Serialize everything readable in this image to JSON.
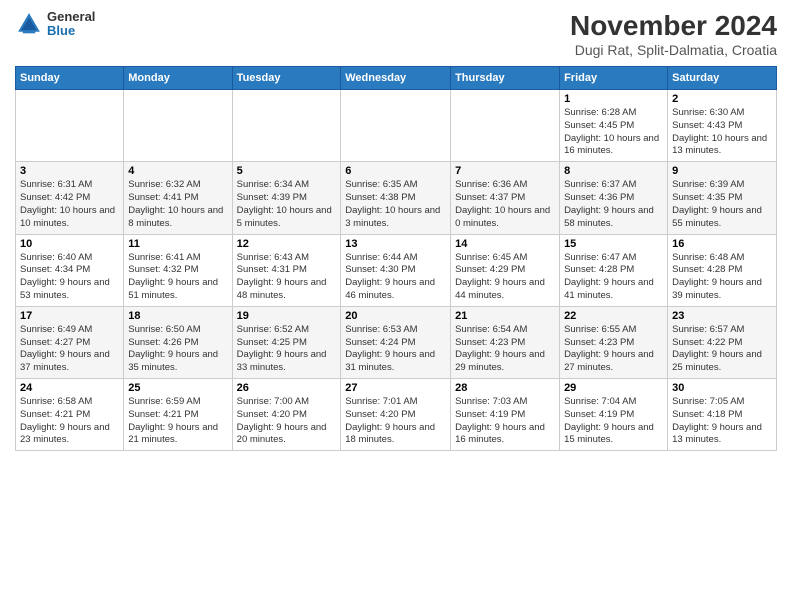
{
  "header": {
    "title": "November 2024",
    "location": "Dugi Rat, Split-Dalmatia, Croatia",
    "logo_general": "General",
    "logo_blue": "Blue"
  },
  "weekdays": [
    "Sunday",
    "Monday",
    "Tuesday",
    "Wednesday",
    "Thursday",
    "Friday",
    "Saturday"
  ],
  "weeks": [
    [
      {
        "day": "",
        "info": ""
      },
      {
        "day": "",
        "info": ""
      },
      {
        "day": "",
        "info": ""
      },
      {
        "day": "",
        "info": ""
      },
      {
        "day": "",
        "info": ""
      },
      {
        "day": "1",
        "info": "Sunrise: 6:28 AM\nSunset: 4:45 PM\nDaylight: 10 hours and 16 minutes."
      },
      {
        "day": "2",
        "info": "Sunrise: 6:30 AM\nSunset: 4:43 PM\nDaylight: 10 hours and 13 minutes."
      }
    ],
    [
      {
        "day": "3",
        "info": "Sunrise: 6:31 AM\nSunset: 4:42 PM\nDaylight: 10 hours and 10 minutes."
      },
      {
        "day": "4",
        "info": "Sunrise: 6:32 AM\nSunset: 4:41 PM\nDaylight: 10 hours and 8 minutes."
      },
      {
        "day": "5",
        "info": "Sunrise: 6:34 AM\nSunset: 4:39 PM\nDaylight: 10 hours and 5 minutes."
      },
      {
        "day": "6",
        "info": "Sunrise: 6:35 AM\nSunset: 4:38 PM\nDaylight: 10 hours and 3 minutes."
      },
      {
        "day": "7",
        "info": "Sunrise: 6:36 AM\nSunset: 4:37 PM\nDaylight: 10 hours and 0 minutes."
      },
      {
        "day": "8",
        "info": "Sunrise: 6:37 AM\nSunset: 4:36 PM\nDaylight: 9 hours and 58 minutes."
      },
      {
        "day": "9",
        "info": "Sunrise: 6:39 AM\nSunset: 4:35 PM\nDaylight: 9 hours and 55 minutes."
      }
    ],
    [
      {
        "day": "10",
        "info": "Sunrise: 6:40 AM\nSunset: 4:34 PM\nDaylight: 9 hours and 53 minutes."
      },
      {
        "day": "11",
        "info": "Sunrise: 6:41 AM\nSunset: 4:32 PM\nDaylight: 9 hours and 51 minutes."
      },
      {
        "day": "12",
        "info": "Sunrise: 6:43 AM\nSunset: 4:31 PM\nDaylight: 9 hours and 48 minutes."
      },
      {
        "day": "13",
        "info": "Sunrise: 6:44 AM\nSunset: 4:30 PM\nDaylight: 9 hours and 46 minutes."
      },
      {
        "day": "14",
        "info": "Sunrise: 6:45 AM\nSunset: 4:29 PM\nDaylight: 9 hours and 44 minutes."
      },
      {
        "day": "15",
        "info": "Sunrise: 6:47 AM\nSunset: 4:28 PM\nDaylight: 9 hours and 41 minutes."
      },
      {
        "day": "16",
        "info": "Sunrise: 6:48 AM\nSunset: 4:28 PM\nDaylight: 9 hours and 39 minutes."
      }
    ],
    [
      {
        "day": "17",
        "info": "Sunrise: 6:49 AM\nSunset: 4:27 PM\nDaylight: 9 hours and 37 minutes."
      },
      {
        "day": "18",
        "info": "Sunrise: 6:50 AM\nSunset: 4:26 PM\nDaylight: 9 hours and 35 minutes."
      },
      {
        "day": "19",
        "info": "Sunrise: 6:52 AM\nSunset: 4:25 PM\nDaylight: 9 hours and 33 minutes."
      },
      {
        "day": "20",
        "info": "Sunrise: 6:53 AM\nSunset: 4:24 PM\nDaylight: 9 hours and 31 minutes."
      },
      {
        "day": "21",
        "info": "Sunrise: 6:54 AM\nSunset: 4:23 PM\nDaylight: 9 hours and 29 minutes."
      },
      {
        "day": "22",
        "info": "Sunrise: 6:55 AM\nSunset: 4:23 PM\nDaylight: 9 hours and 27 minutes."
      },
      {
        "day": "23",
        "info": "Sunrise: 6:57 AM\nSunset: 4:22 PM\nDaylight: 9 hours and 25 minutes."
      }
    ],
    [
      {
        "day": "24",
        "info": "Sunrise: 6:58 AM\nSunset: 4:21 PM\nDaylight: 9 hours and 23 minutes."
      },
      {
        "day": "25",
        "info": "Sunrise: 6:59 AM\nSunset: 4:21 PM\nDaylight: 9 hours and 21 minutes."
      },
      {
        "day": "26",
        "info": "Sunrise: 7:00 AM\nSunset: 4:20 PM\nDaylight: 9 hours and 20 minutes."
      },
      {
        "day": "27",
        "info": "Sunrise: 7:01 AM\nSunset: 4:20 PM\nDaylight: 9 hours and 18 minutes."
      },
      {
        "day": "28",
        "info": "Sunrise: 7:03 AM\nSunset: 4:19 PM\nDaylight: 9 hours and 16 minutes."
      },
      {
        "day": "29",
        "info": "Sunrise: 7:04 AM\nSunset: 4:19 PM\nDaylight: 9 hours and 15 minutes."
      },
      {
        "day": "30",
        "info": "Sunrise: 7:05 AM\nSunset: 4:18 PM\nDaylight: 9 hours and 13 minutes."
      }
    ]
  ]
}
